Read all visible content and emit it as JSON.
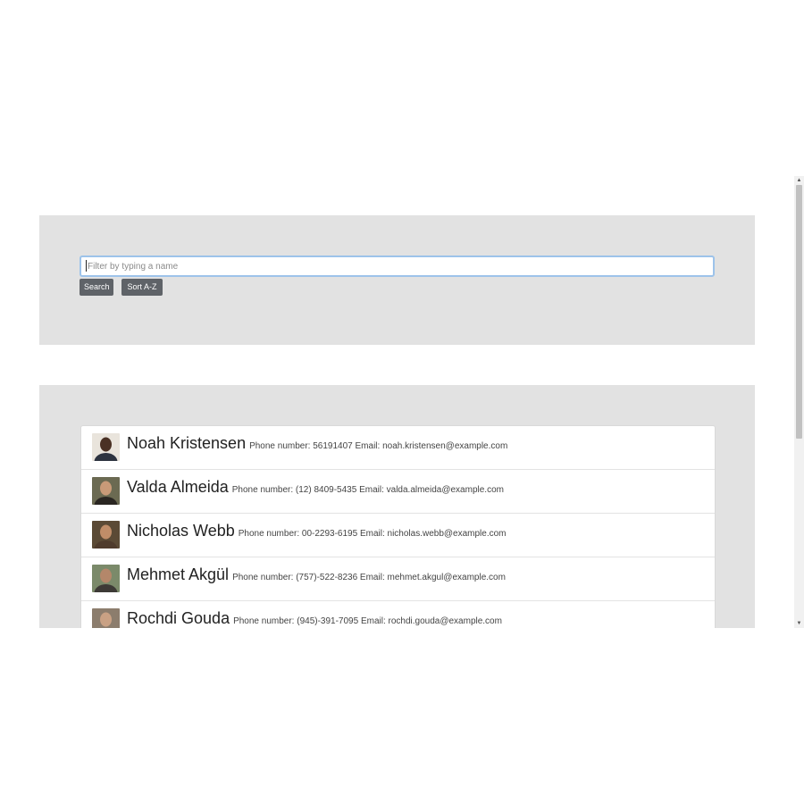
{
  "search": {
    "placeholder": "Filter by typing a name",
    "value": "",
    "search_label": "Search",
    "sort_label": "Sort A-Z"
  },
  "contacts": [
    {
      "name": "Noah Kristensen",
      "details": "Phone number: 56191407 Email: noah.kristensen@example.com",
      "avatar_colors": {
        "bg": "#e9e4dc",
        "skin": "#4a3125",
        "clothes": "#2d3340"
      }
    },
    {
      "name": "Valda Almeida",
      "details": "Phone number: (12) 8409-5435 Email: valda.almeida@example.com",
      "avatar_colors": {
        "bg": "#6b6a52",
        "skin": "#c89a78",
        "clothes": "#2a2622"
      }
    },
    {
      "name": "Nicholas Webb",
      "details": "Phone number: 00-2293-6195 Email: nicholas.webb@example.com",
      "avatar_colors": {
        "bg": "#5b4a35",
        "skin": "#c08d68",
        "clothes": "#4f3b2c"
      }
    },
    {
      "name": "Mehmet Akgül",
      "details": "Phone number: (757)-522-8236 Email: mehmet.akgul@example.com",
      "avatar_colors": {
        "bg": "#7b8a6a",
        "skin": "#b4876a",
        "clothes": "#3d3a36"
      }
    },
    {
      "name": "Rochdi Gouda",
      "details": "Phone number: (945)-391-7095 Email: rochdi.gouda@example.com",
      "avatar_colors": {
        "bg": "#8c7d6d",
        "skin": "#c9a184",
        "clothes": "#5a4e44"
      }
    }
  ],
  "colors": {
    "panel_bg": "#e2e2e2",
    "button_bg": "#5f6368",
    "input_focus_border": "#9dc3ea"
  }
}
